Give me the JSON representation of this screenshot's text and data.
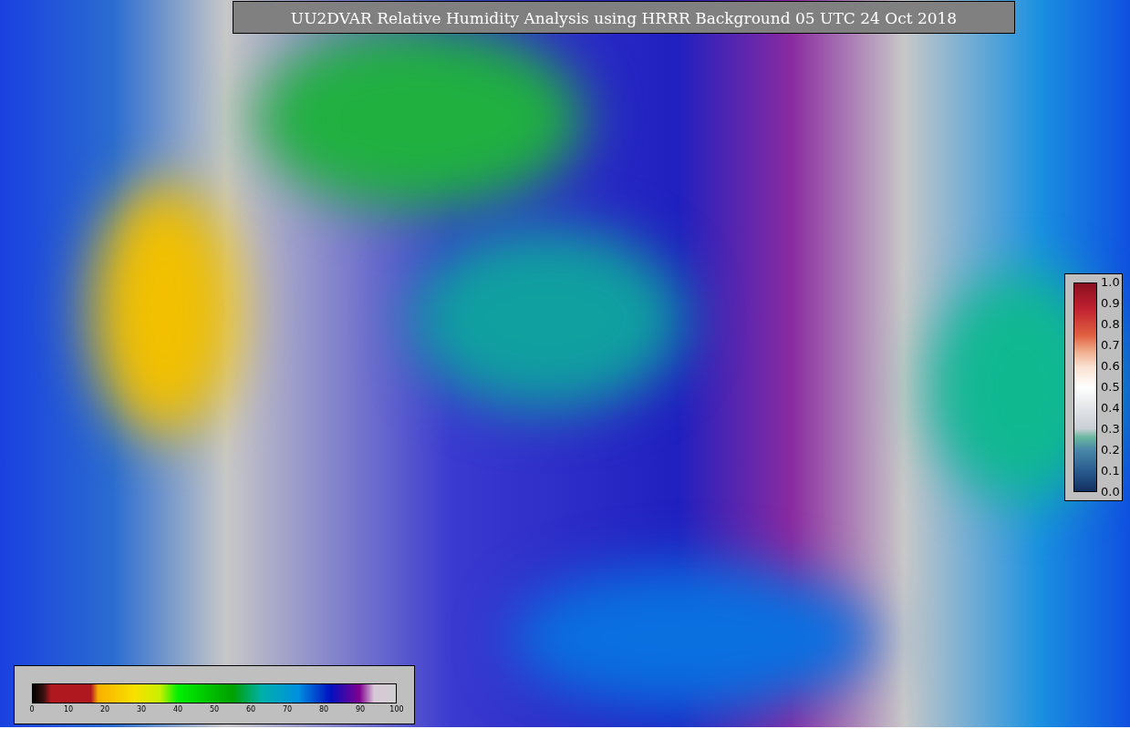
{
  "title": "UU2DVAR Relative Humidity Analysis using HRRR Background 05 UTC 24 Oct 2018",
  "humidity_colorbar": {
    "ticks": [
      "0",
      "10",
      "20",
      "30",
      "40",
      "50",
      "60",
      "70",
      "80",
      "90",
      "100"
    ]
  },
  "station_colorbar": {
    "ticks": [
      "1.0",
      "0.9",
      "0.8",
      "0.7",
      "0.6",
      "0.5",
      "0.4",
      "0.3",
      "0.2",
      "0.1",
      "0.0"
    ]
  }
}
